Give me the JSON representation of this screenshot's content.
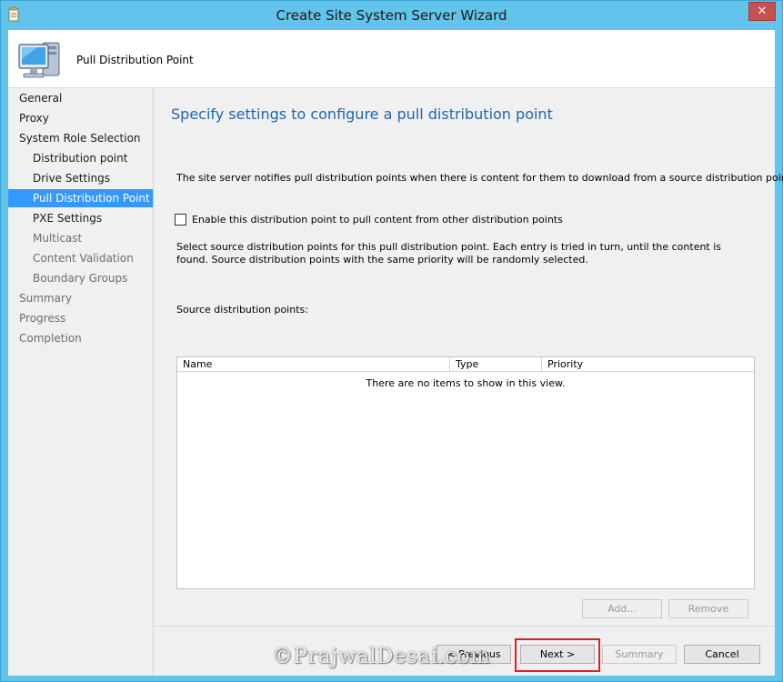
{
  "window": {
    "title": "Create Site System Server Wizard",
    "close_label": "✕"
  },
  "header": {
    "title": "Pull Distribution Point"
  },
  "nav": {
    "items": [
      {
        "label": "General",
        "level": 0,
        "state": "normal"
      },
      {
        "label": "Proxy",
        "level": 0,
        "state": "normal"
      },
      {
        "label": "System Role Selection",
        "level": 0,
        "state": "normal"
      },
      {
        "label": "Distribution point",
        "level": 1,
        "state": "normal"
      },
      {
        "label": "Drive Settings",
        "level": 1,
        "state": "normal"
      },
      {
        "label": "Pull Distribution Point",
        "level": 1,
        "state": "active"
      },
      {
        "label": "PXE Settings",
        "level": 1,
        "state": "normal"
      },
      {
        "label": "Multicast",
        "level": 1,
        "state": "disabled"
      },
      {
        "label": "Content Validation",
        "level": 1,
        "state": "disabled"
      },
      {
        "label": "Boundary Groups",
        "level": 1,
        "state": "disabled"
      },
      {
        "label": "Summary",
        "level": 0,
        "state": "disabled"
      },
      {
        "label": "Progress",
        "level": 0,
        "state": "disabled"
      },
      {
        "label": "Completion",
        "level": 0,
        "state": "disabled"
      }
    ]
  },
  "content": {
    "page_title": "Specify settings to configure a pull distribution point",
    "description": "The site server notifies pull distribution points when there is content for them to download from a source distribution point.",
    "checkbox_label": "Enable this distribution point to pull content from other distribution points",
    "checkbox_checked": false,
    "select_description": "Select source distribution points for this pull distribution point. Each entry is tried in turn, until the content is found. Source distribution points with the same priority will be randomly selected.",
    "source_label": "Source distribution points:",
    "list": {
      "columns": [
        "Name",
        "Type",
        "Priority"
      ],
      "empty_text": "There are no items to show in this view."
    },
    "add_label": "Add...",
    "remove_label": "Remove"
  },
  "footer": {
    "previous_label": "< Previous",
    "next_label": "Next >",
    "summary_label": "Summary",
    "cancel_label": "Cancel"
  },
  "watermark": "©PrajwalDesai.com",
  "colors": {
    "frame": "#62c4ea",
    "accent_title": "#1e64b4",
    "active_nav": "#3399ff",
    "highlight_box": "#e02020"
  }
}
